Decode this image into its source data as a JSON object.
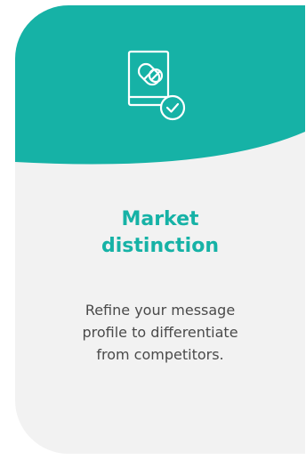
{
  "card": {
    "icon": "medicine-book-check-icon",
    "title_lines": [
      "Market",
      "distinction"
    ],
    "body_lines": [
      "Refine your message",
      "profile to differentiate",
      "from competitors."
    ]
  },
  "colors": {
    "accent": "#16b2a6",
    "card_background": "#f2f2f2",
    "body_text": "#4a4a4a",
    "icon_stroke": "#ffffff"
  }
}
